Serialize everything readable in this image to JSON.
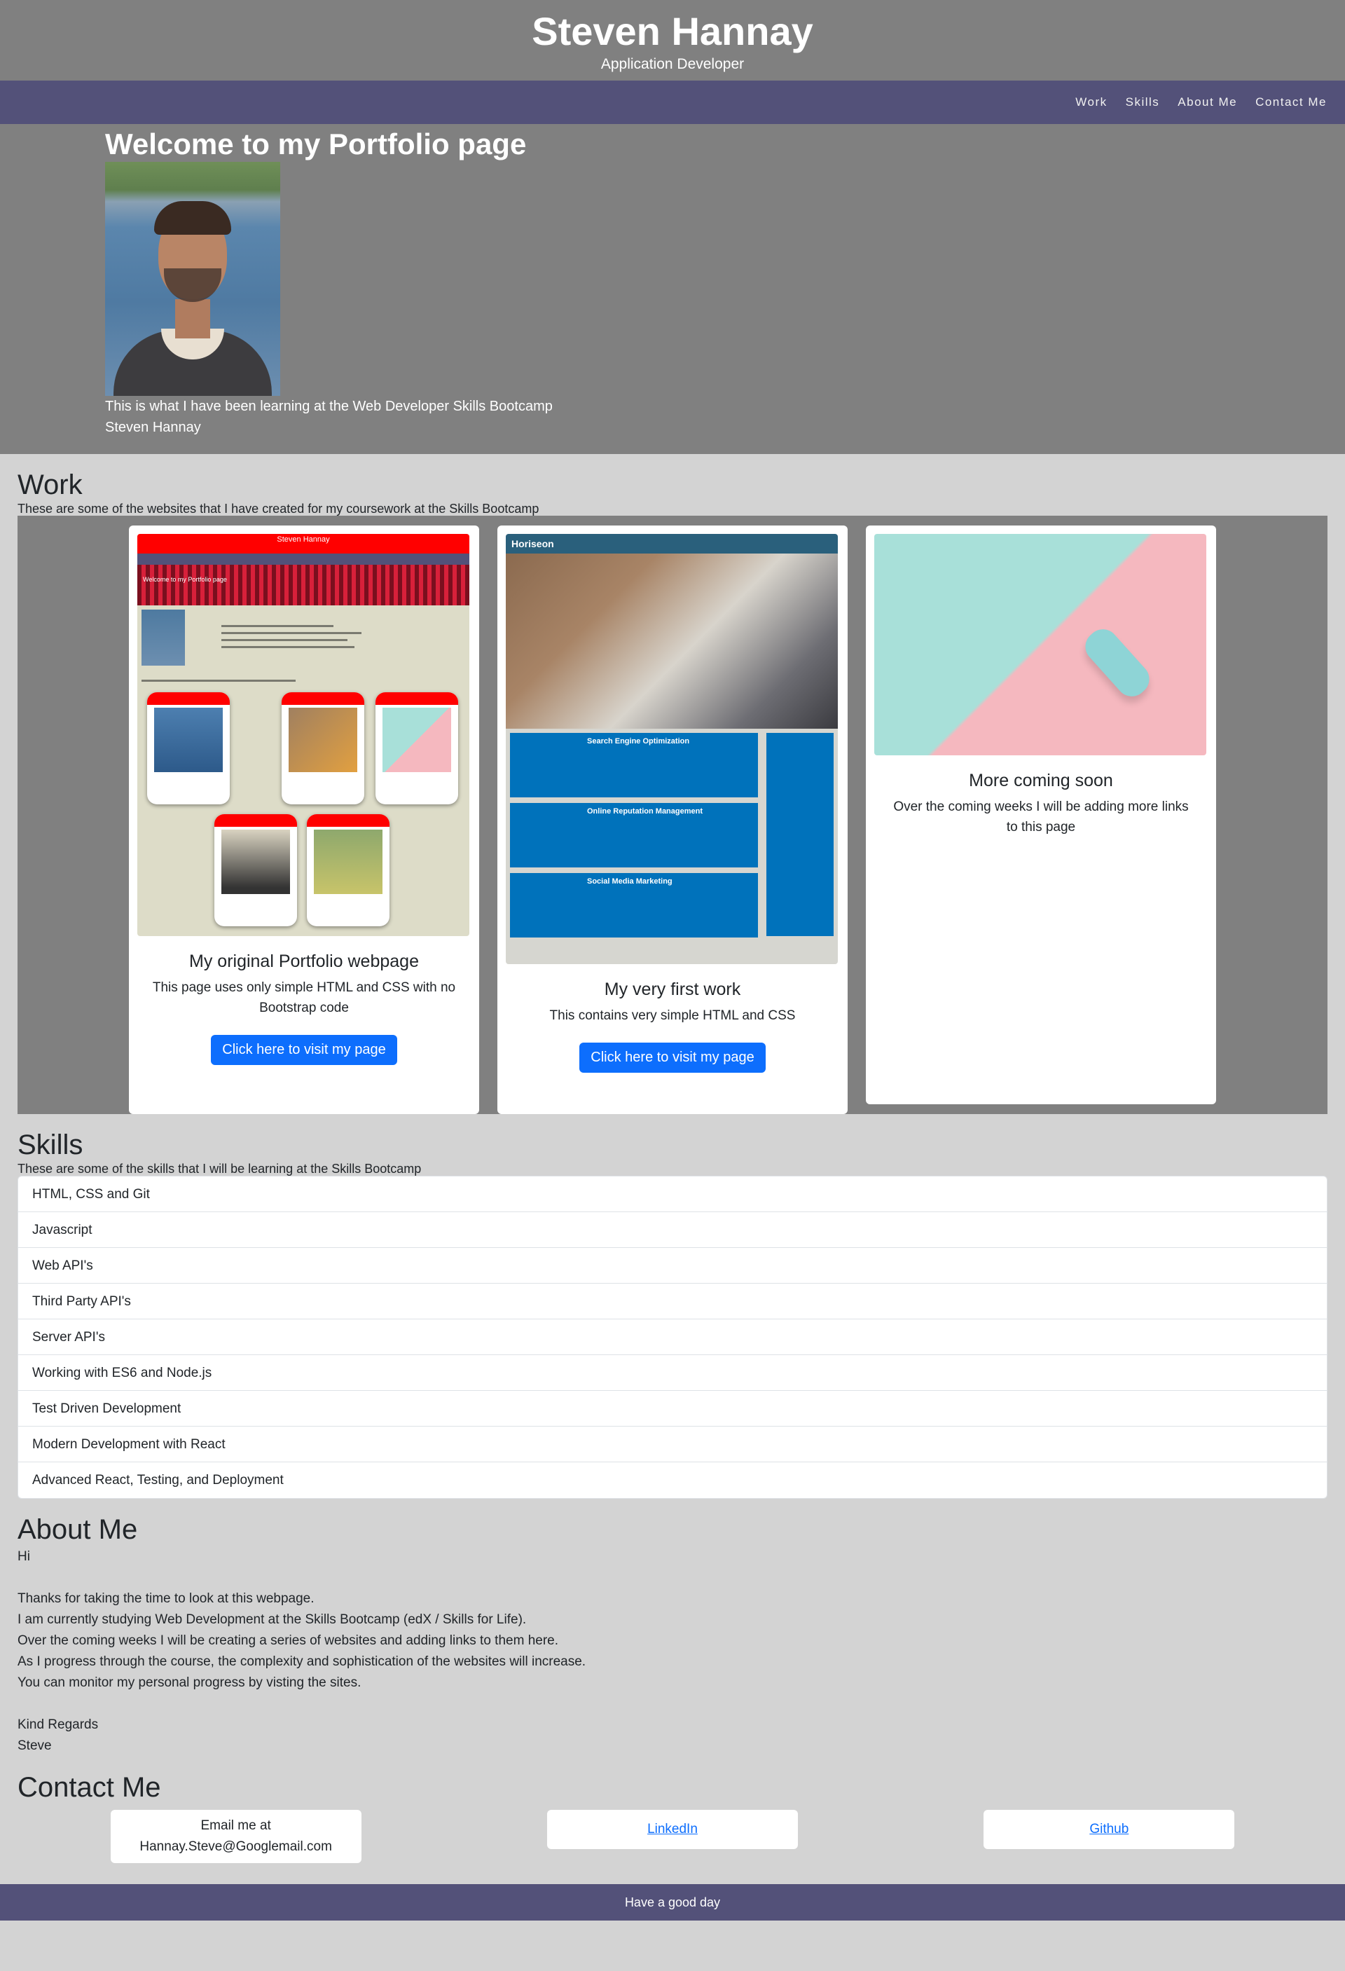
{
  "header": {
    "name": "Steven Hannay",
    "subtitle": "Application Developer"
  },
  "nav": {
    "items": [
      "Work",
      "Skills",
      "About Me",
      "Contact Me"
    ]
  },
  "hero": {
    "title": "Welcome to my Portfolio page",
    "caption": "This is what I have been learning at the Web Developer Skills Bootcamp",
    "author": "Steven Hannay"
  },
  "work": {
    "title": "Work",
    "intro": "These are some of the websites that I have created for my coursework at the Skills Bootcamp",
    "cards": [
      {
        "title": "My original Portfolio webpage",
        "description": "This page uses only simple HTML and CSS with no Bootstrap code",
        "button": "Click here to visit my page",
        "thumb": {
          "header": "Steven Hannay",
          "hero": "Welcome to my Portfolio page"
        }
      },
      {
        "title": "My very first work",
        "description": "This contains very simple HTML and CSS",
        "button": "Click here to visit my page",
        "thumb": {
          "brand": "Horiseon",
          "items": [
            "Search Engine Optimization",
            "Online Reputation Management",
            "Social Media Marketing"
          ]
        }
      },
      {
        "title": "More coming soon",
        "description": "Over the coming weeks I will be adding more links to this page"
      }
    ]
  },
  "skills": {
    "title": "Skills",
    "intro": "These are some of the skills that I will be learning at the Skills Bootcamp",
    "items": [
      "HTML, CSS and Git",
      "Javascript",
      "Web API's",
      "Third Party API's",
      "Server API's",
      "Working with ES6 and Node.js",
      "Test Driven Development",
      "Modern Development with React",
      "Advanced React, Testing, and Deployment"
    ]
  },
  "about": {
    "title": "About Me",
    "greeting": "Hi",
    "lines": [
      "Thanks for taking the time to look at this webpage.",
      "I am currently studying Web Development at the Skills Bootcamp (edX / Skills for Life).",
      "Over the coming weeks I will be creating a series of websites and adding links to them here.",
      "As I progress through the course, the complexity and sophistication of the websites will increase.",
      "You can monitor my personal progress by visting the sites."
    ],
    "signoff": "Kind Regards",
    "signature": "Steve"
  },
  "contact": {
    "title": "Contact Me",
    "email_label": "Email me at",
    "email": "Hannay.Steve@Googlemail.com",
    "linkedin": "LinkedIn",
    "github": "Github"
  },
  "footer": {
    "text": "Have a good day"
  },
  "colors": {
    "header": "#808080",
    "nav": "#535179",
    "page": "#d3d3d3",
    "button": "#0d6efd",
    "thumb_red": "#ff0000",
    "horiseon": "#0072bb"
  }
}
